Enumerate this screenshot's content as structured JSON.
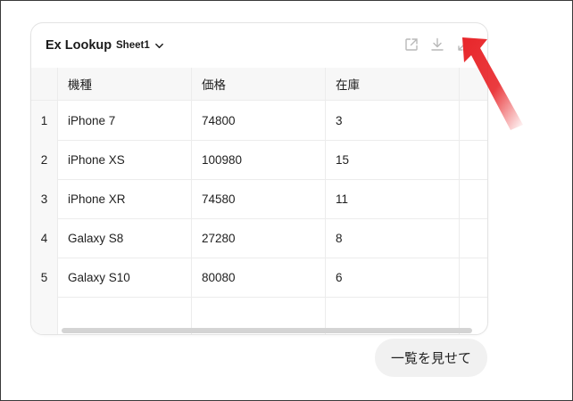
{
  "header": {
    "title": "Ex Lookup",
    "sheet": "Sheet1"
  },
  "icons": {
    "open": "external-link-icon",
    "download": "download-icon",
    "expand": "expand-icon",
    "chevron": "chevron-down-icon"
  },
  "table": {
    "columns": [
      "機種",
      "価格",
      "在庫"
    ],
    "rows": [
      {
        "index": "1",
        "model": "iPhone 7",
        "price": "74800",
        "stock": "3"
      },
      {
        "index": "2",
        "model": "iPhone XS",
        "price": "100980",
        "stock": "15"
      },
      {
        "index": "3",
        "model": "iPhone XR",
        "price": "74580",
        "stock": "11"
      },
      {
        "index": "4",
        "model": "Galaxy S8",
        "price": "27280",
        "stock": "8"
      },
      {
        "index": "5",
        "model": "Galaxy S10",
        "price": "80080",
        "stock": "6"
      }
    ]
  },
  "suggestion": "一覧を見せて",
  "colors": {
    "annotation_arrow": "#e8262a",
    "chip_bg": "#f1f1f1"
  }
}
